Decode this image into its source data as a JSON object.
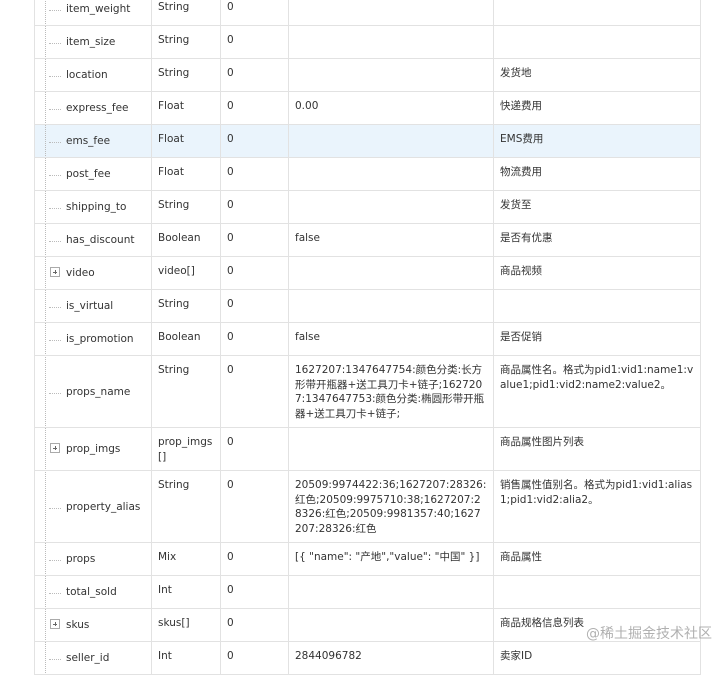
{
  "rows": [
    {
      "name": "item_weight",
      "type": "String",
      "required": "0",
      "example": "",
      "desc": "",
      "expand": false,
      "highlight": false
    },
    {
      "name": "item_size",
      "type": "String",
      "required": "0",
      "example": "",
      "desc": "",
      "expand": false,
      "highlight": false
    },
    {
      "name": "location",
      "type": "String",
      "required": "0",
      "example": "",
      "desc": "发货地",
      "expand": false,
      "highlight": false
    },
    {
      "name": "express_fee",
      "type": "Float",
      "required": "0",
      "example": "0.00",
      "desc": "快递费用",
      "expand": false,
      "highlight": false
    },
    {
      "name": "ems_fee",
      "type": "Float",
      "required": "0",
      "example": "",
      "desc": "EMS费用",
      "expand": false,
      "highlight": true
    },
    {
      "name": "post_fee",
      "type": "Float",
      "required": "0",
      "example": "",
      "desc": "物流费用",
      "expand": false,
      "highlight": false
    },
    {
      "name": "shipping_to",
      "type": "String",
      "required": "0",
      "example": "",
      "desc": "发货至",
      "expand": false,
      "highlight": false
    },
    {
      "name": "has_discount",
      "type": "Boolean",
      "required": "0",
      "example": "false",
      "desc": "是否有优惠",
      "expand": false,
      "highlight": false
    },
    {
      "name": "video",
      "type": "video[]",
      "required": "0",
      "example": "",
      "desc": "商品视频",
      "expand": true,
      "highlight": false
    },
    {
      "name": "is_virtual",
      "type": "String",
      "required": "0",
      "example": "",
      "desc": "",
      "expand": false,
      "highlight": false
    },
    {
      "name": "is_promotion",
      "type": "Boolean",
      "required": "0",
      "example": "false",
      "desc": "是否促销",
      "expand": false,
      "highlight": false
    },
    {
      "name": "props_name",
      "type": "String",
      "required": "0",
      "example": "1627207:1347647754:颜色分类:长方形带开瓶器+送工具刀卡+链子;1627207:1347647753:颜色分类:椭圆形带开瓶器+送工具刀卡+链子;",
      "desc": "商品属性名。格式为pid1:vid1:name1:value1;pid1:vid2:name2:value2。",
      "expand": false,
      "highlight": false
    },
    {
      "name": "prop_imgs",
      "type": "prop_imgs[]",
      "required": "0",
      "example": "",
      "desc": "商品属性图片列表",
      "expand": true,
      "highlight": false
    },
    {
      "name": "property_alias",
      "type": "String",
      "required": "0",
      "example": "20509:9974422:36;1627207:28326:红色;20509:9975710:38;1627207:28326:红色;20509:9981357:40;1627207:28326:红色",
      "desc": "销售属性值别名。格式为pid1:vid1:alias1;pid1:vid2:alia2。",
      "expand": false,
      "highlight": false
    },
    {
      "name": "props",
      "type": "Mix",
      "required": "0",
      "example": "[{ \"name\": \"产地\",\"value\": \"中国\" }]",
      "desc": "商品属性",
      "expand": false,
      "highlight": false
    },
    {
      "name": "total_sold",
      "type": "Int",
      "required": "0",
      "example": "",
      "desc": "",
      "expand": false,
      "highlight": false
    },
    {
      "name": "skus",
      "type": "skus[]",
      "required": "0",
      "example": "",
      "desc": "商品规格信息列表",
      "expand": true,
      "highlight": false
    },
    {
      "name": "seller_id",
      "type": "Int",
      "required": "0",
      "example": "2844096782",
      "desc": "卖家ID",
      "expand": false,
      "highlight": false
    }
  ],
  "watermark": "@稀土掘金技术社区"
}
